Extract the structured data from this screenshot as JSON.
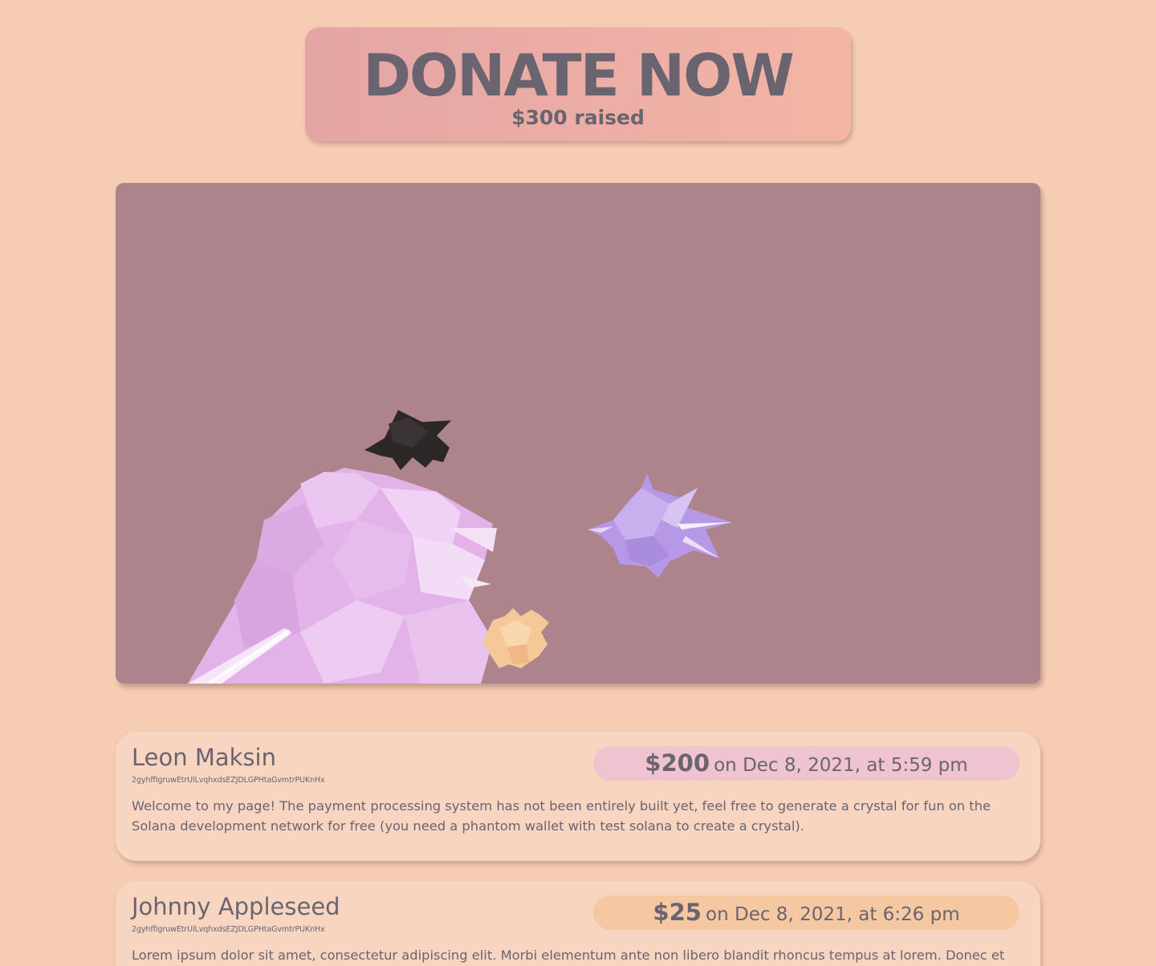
{
  "donate": {
    "title": "DONATE NOW",
    "raised": "$300 raised"
  },
  "colors": {
    "page_background": "#f6cdb3",
    "canvas_background": "#ae848c",
    "text": "#6a6470",
    "button_gradient": [
      "#e4a5a5",
      "#f3b5a5"
    ],
    "crystals": {
      "pink": "#e6b8ec",
      "purple": "#b89ce8",
      "orange": "#f6c898",
      "dark": "#2c2828"
    }
  },
  "donations": [
    {
      "name": "Leon Maksin",
      "wallet": "2gyhffIgruwEtrUlLvqhxdsEZJDLGPHtaGvmtrPUKnHx",
      "amount": "$200",
      "date": "on Dec 8, 2021, at 5:59 pm",
      "message": "Welcome to my page! The payment processing system has not been entirely built yet, feel free to generate a crystal for fun on the Solana development network for free (you need a phantom wallet with test solana to create a crystal).",
      "pill_color": "#efc3cf"
    },
    {
      "name": "Johnny Appleseed",
      "wallet": "2gyhffIgruwEtrUlLvqhxdsEZJDLGPHtaGvmtrPUKnHx",
      "amount": "$25",
      "date": "on Dec 8, 2021, at 6:26 pm",
      "message": "Lorem ipsum dolor sit amet, consectetur adipiscing elit. Morbi elementum ante non libero blandit rhoncus tempus at lorem. Donec et",
      "pill_color": "#f6c8a2"
    }
  ]
}
